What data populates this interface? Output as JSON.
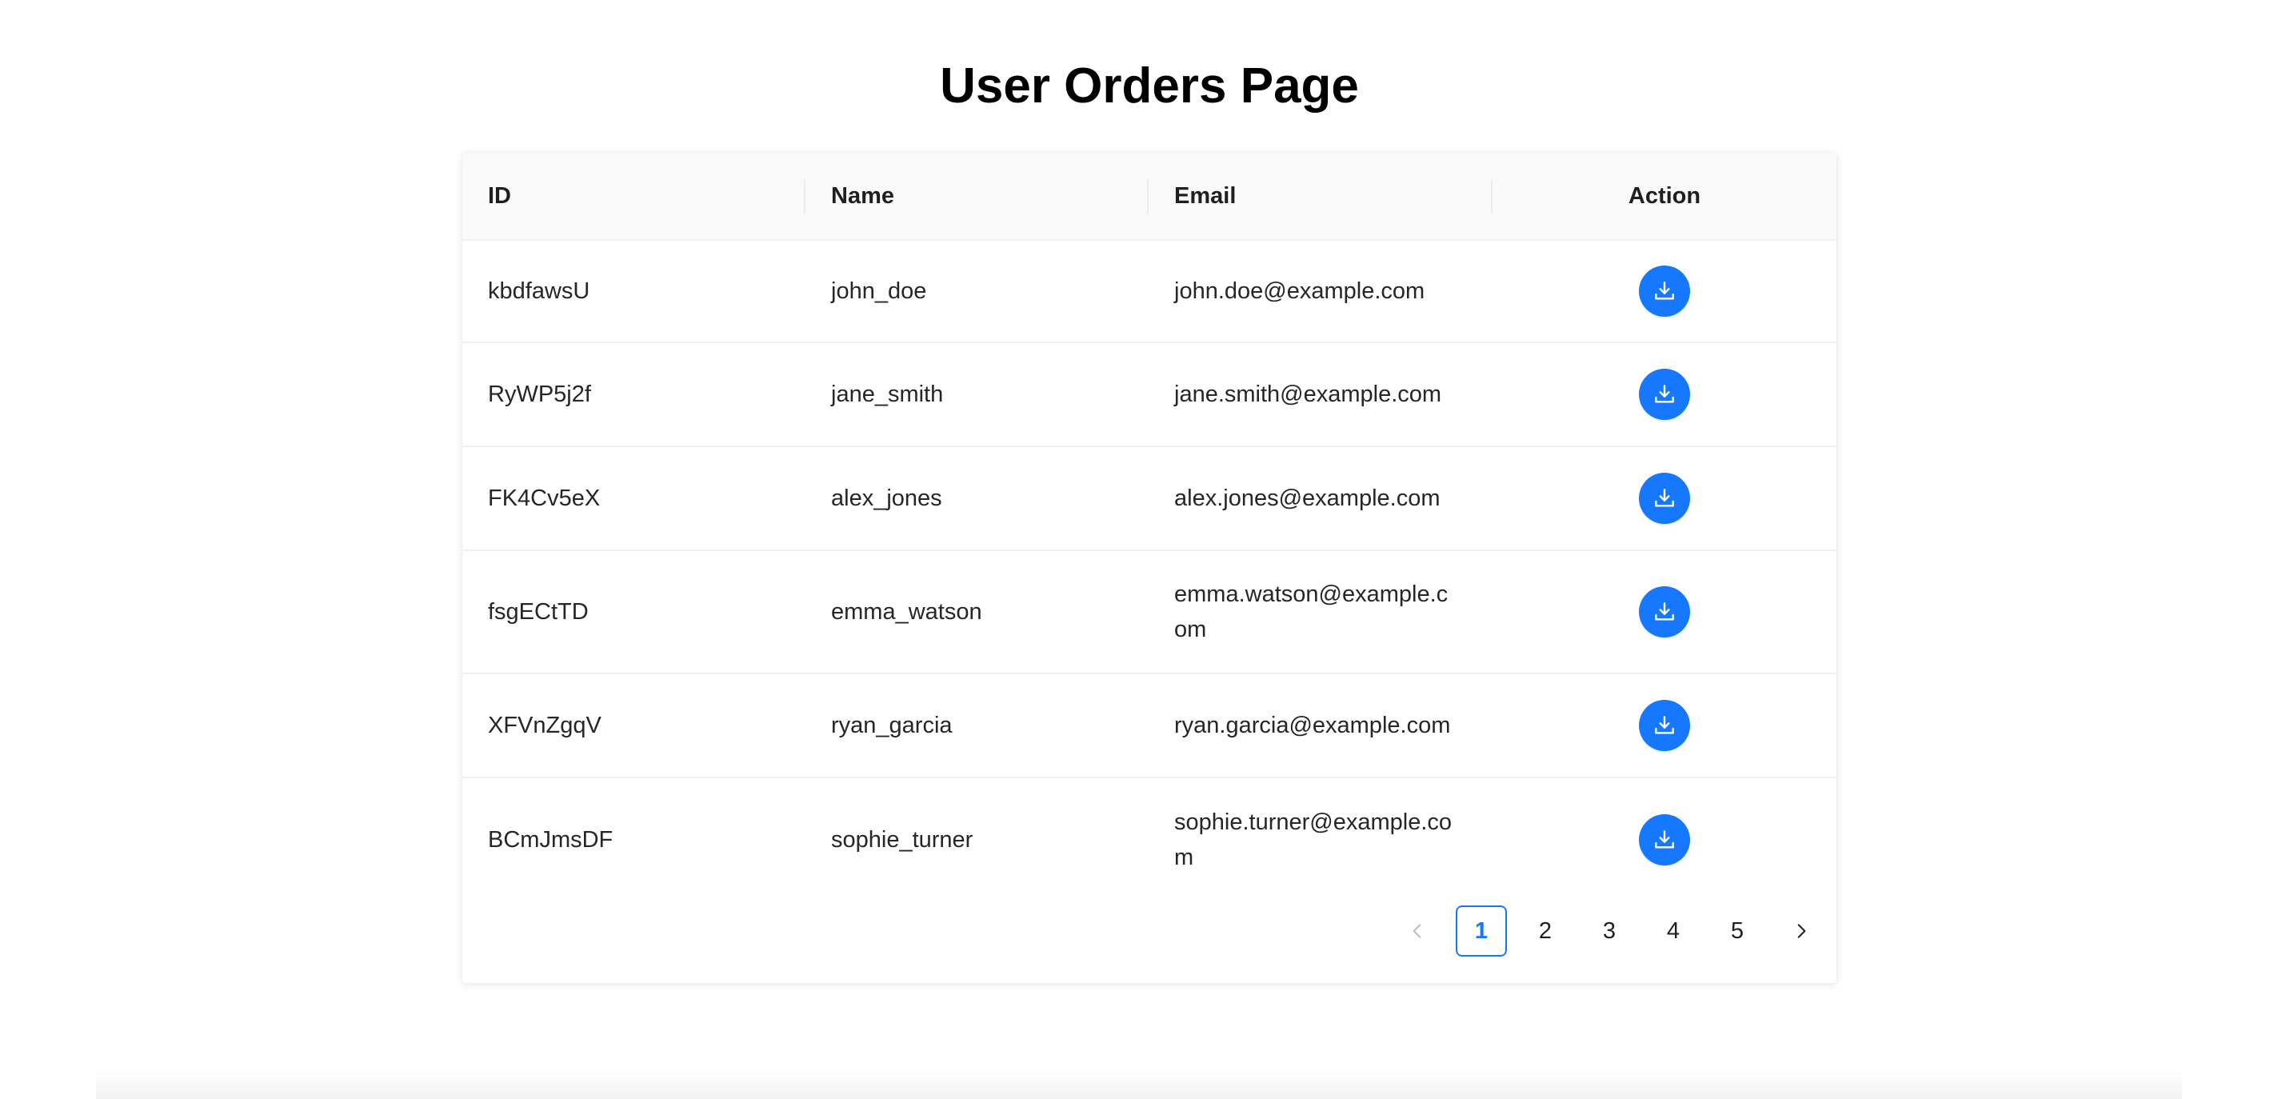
{
  "page": {
    "title": "User Orders Page"
  },
  "table": {
    "columns": [
      "ID",
      "Name",
      "Email",
      "Action"
    ],
    "rows": [
      {
        "id": "kbdfawsU",
        "name": "john_doe",
        "email": "john.doe@example.com"
      },
      {
        "id": "RyWP5j2f",
        "name": "jane_smith",
        "email": "jane.smith@example.com"
      },
      {
        "id": "FK4Cv5eX",
        "name": "alex_jones",
        "email": "alex.jones@example.com"
      },
      {
        "id": "fsgECtTD",
        "name": "emma_watson",
        "email": "emma.watson@example.com"
      },
      {
        "id": "XFVnZgqV",
        "name": "ryan_garcia",
        "email": "ryan.garcia@example.com"
      },
      {
        "id": "BCmJmsDF",
        "name": "sophie_turner",
        "email": "sophie.turner@example.com"
      }
    ],
    "action_icon": "download-icon"
  },
  "pagination": {
    "pages": [
      "1",
      "2",
      "3",
      "4",
      "5"
    ],
    "current": "1",
    "prev_icon": "chevron-left-icon",
    "next_icon": "chevron-right-icon"
  },
  "colors": {
    "accent": "#1677ff",
    "header_bg": "#fafafa",
    "border": "#f0f0f0",
    "text": "#262626"
  }
}
